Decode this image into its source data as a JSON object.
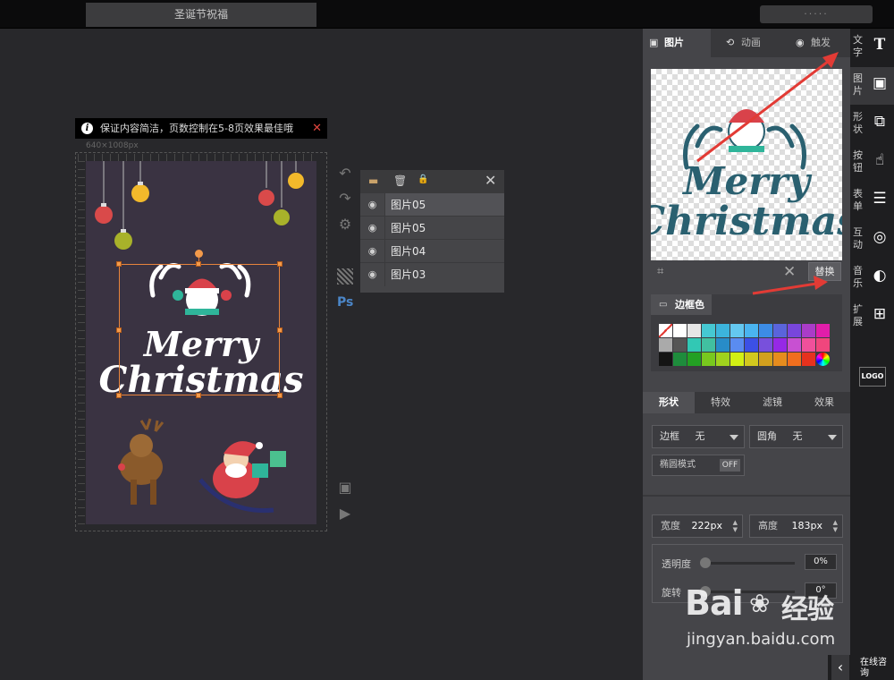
{
  "header": {
    "doc_title": "圣诞节祝福",
    "user_masked": "·····"
  },
  "tip": {
    "text": "保证内容简洁，页数控制在5-8页效果最佳哦",
    "close": "✕"
  },
  "canvas": {
    "size_label": "640×1008px",
    "page_bg": "#3a3342"
  },
  "artwork": {
    "line1": "Merry",
    "line2": "Christmas"
  },
  "layers": {
    "items": [
      {
        "label": "图片05",
        "active": true
      },
      {
        "label": "图片05",
        "active": false
      },
      {
        "label": "图片04",
        "active": false
      },
      {
        "label": "图片03",
        "active": false
      }
    ]
  },
  "panel": {
    "tabs": [
      {
        "label": "图片",
        "icon": "image-icon"
      },
      {
        "label": "动画",
        "icon": "animation-icon"
      },
      {
        "label": "触发",
        "icon": "trigger-icon"
      }
    ],
    "replace_label": "替换",
    "border_color_label": "边框色",
    "swatches": [
      "#ffffff",
      "#ffffff",
      "#e6e6e6",
      "#46c8d2",
      "#3cb4dc",
      "#64c8f0",
      "#4ab4f0",
      "#3c8ce6",
      "#5a64dc",
      "#7846dc",
      "#aa3cc8",
      "#e11eaa",
      "#aaaaaa",
      "#555555",
      "#32c8b4",
      "#41c0a0",
      "#288cc8",
      "#5a8cf0",
      "#3c50e6",
      "#7850dc",
      "#9628e6",
      "#c850d2",
      "#f0509b",
      "#f0467d",
      "#141414",
      "#1e8c3c",
      "#23a023",
      "#78c81e",
      "#a0d21e",
      "#d2f014",
      "#d2c81e",
      "#d2a01e",
      "#e68c1e",
      "#f06e1e",
      "#e6321e",
      "rainbow"
    ],
    "sub_tabs": [
      "形状",
      "特效",
      "滤镜",
      "效果"
    ],
    "border_dd": {
      "label": "边框",
      "value": "无"
    },
    "radius_dd": {
      "label": "圆角",
      "value": "无"
    },
    "ellipse_mode": {
      "label": "椭圆模式",
      "state": "OFF"
    },
    "width": {
      "label": "宽度",
      "value": "222px"
    },
    "height": {
      "label": "高度",
      "value": "183px"
    },
    "opacity": {
      "label": "透明度",
      "value": "0%",
      "level": 0
    },
    "rotation": {
      "label": "旋转",
      "value": "0°",
      "level": 0
    }
  },
  "sidebar": {
    "items": [
      {
        "label": "文字",
        "icon": "text-icon",
        "active": false
      },
      {
        "label": "图片",
        "icon": "image-icon",
        "active": true
      },
      {
        "label": "形状",
        "icon": "shape-icon",
        "active": false
      },
      {
        "label": "按钮",
        "icon": "button-icon",
        "active": false
      },
      {
        "label": "表单",
        "icon": "form-icon",
        "active": false
      },
      {
        "label": "互动",
        "icon": "fingerprint-icon",
        "active": false
      },
      {
        "label": "音乐",
        "icon": "music-icon",
        "active": false
      },
      {
        "label": "扩展",
        "icon": "extend-icon",
        "active": false
      }
    ],
    "logo": "LOGO",
    "chat": "在线咨询"
  },
  "watermark": {
    "brand": "Bai",
    "brand2": "经验",
    "url": "jingyan.baidu.com"
  },
  "colors": {
    "accent_orange": "#e8843c",
    "annotation_red": "#e23b35"
  }
}
